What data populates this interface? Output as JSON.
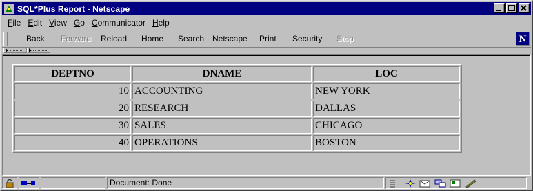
{
  "window": {
    "title": "SQL*Plus Report - Netscape",
    "icon": "netscape-app-icon"
  },
  "menu": [
    {
      "label": "File",
      "key": "F",
      "rest": "ile"
    },
    {
      "label": "Edit",
      "key": "E",
      "rest": "dit"
    },
    {
      "label": "View",
      "key": "V",
      "rest": "iew"
    },
    {
      "label": "Go",
      "key": "G",
      "rest": "o"
    },
    {
      "label": "Communicator",
      "key": "C",
      "rest": "ommunicator"
    },
    {
      "label": "Help",
      "key": "H",
      "rest": "elp"
    }
  ],
  "toolbar": {
    "back": "Back",
    "forward": "Forward",
    "reload": "Reload",
    "home": "Home",
    "search": "Search",
    "netscape": "Netscape",
    "print": "Print",
    "security": "Security",
    "stop": "Stop",
    "logo": "N"
  },
  "table": {
    "headers": [
      "DEPTNO",
      "DNAME",
      "LOC"
    ],
    "rows": [
      {
        "deptno": "10",
        "dname": "ACCOUNTING",
        "loc": "NEW YORK"
      },
      {
        "deptno": "20",
        "dname": "RESEARCH",
        "loc": "DALLAS"
      },
      {
        "deptno": "30",
        "dname": "SALES",
        "loc": "CHICAGO"
      },
      {
        "deptno": "40",
        "dname": "OPERATIONS",
        "loc": "BOSTON"
      }
    ]
  },
  "status": {
    "text": "Document: Done"
  },
  "colors": {
    "titlebar": "#000080",
    "chrome": "#c0c0c0"
  }
}
